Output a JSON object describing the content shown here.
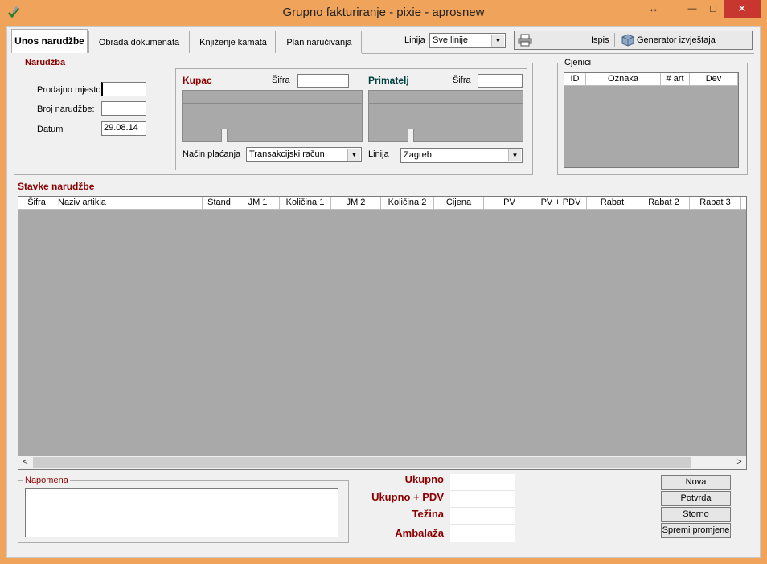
{
  "window": {
    "title": "Grupno fakturiranje - pixie - aprosnew",
    "resize_glyph": "↔",
    "minimize_glyph": "—",
    "maximize_glyph": "□",
    "close_glyph": "✕",
    "app_icon": "pen-check-icon",
    "accent_color": "#f0a35a",
    "close_color": "#c7372f"
  },
  "tabs": [
    {
      "label": "Unos narudžbe",
      "active": true
    },
    {
      "label": "Obrada dokumenata",
      "active": false
    },
    {
      "label": "Knjiženje kamata",
      "active": false
    },
    {
      "label": "Plan naručivanja",
      "active": false
    }
  ],
  "toolbar": {
    "linija_label": "Linija",
    "linija_value": "Sve linije",
    "ispis_label": "Ispis",
    "ispis_icon": "printer-icon",
    "generator_label": "Generator izvještaja",
    "generator_icon": "box-icon"
  },
  "narudzba": {
    "legend": "Narudžba",
    "prodajno_mjesto_label": "Prodajno mjesto",
    "prodajno_mjesto_value": "",
    "broj_narudzbe_label": "Broj narudžbe:",
    "broj_narudzbe_value": "",
    "datum_label": "Datum",
    "datum_value": "29.08.14"
  },
  "kupac": {
    "label": "Kupac",
    "sifra_label": "Šifra",
    "sifra_value": "",
    "nacin_placanja_label": "Način plaćanja",
    "nacin_placanja_value": "Transakcijski račun"
  },
  "primatelj": {
    "label": "Primatelj",
    "sifra_label": "Šifra",
    "sifra_value": "",
    "linija_label": "Linija",
    "linija_value": "Zagreb"
  },
  "cjenici": {
    "legend": "Cjenici",
    "columns": [
      "ID",
      "Oznaka",
      "# art",
      "Dev"
    ]
  },
  "stavke": {
    "title": "Stavke narudžbe",
    "columns": [
      "Šifra",
      "Naziv artikla",
      "Stand",
      "JM 1",
      "Količina 1",
      "JM 2",
      "Količina 2",
      "Cijena",
      "PV",
      "PV + PDV",
      "Rabat",
      "Rabat 2",
      "Rabat 3"
    ],
    "scroll_left": "<",
    "scroll_right": ">"
  },
  "napomena": {
    "legend": "Napomena",
    "value": ""
  },
  "totals": {
    "ukupno_label": "Ukupno",
    "ukupno_pdv_label": "Ukupno + PDV",
    "tezina_label": "Težina",
    "ambalaza_label": "Ambalaža"
  },
  "actions": {
    "nova": "Nova",
    "potvrda": "Potvrda",
    "storno": "Storno",
    "spremi": "Spremi promjene"
  }
}
